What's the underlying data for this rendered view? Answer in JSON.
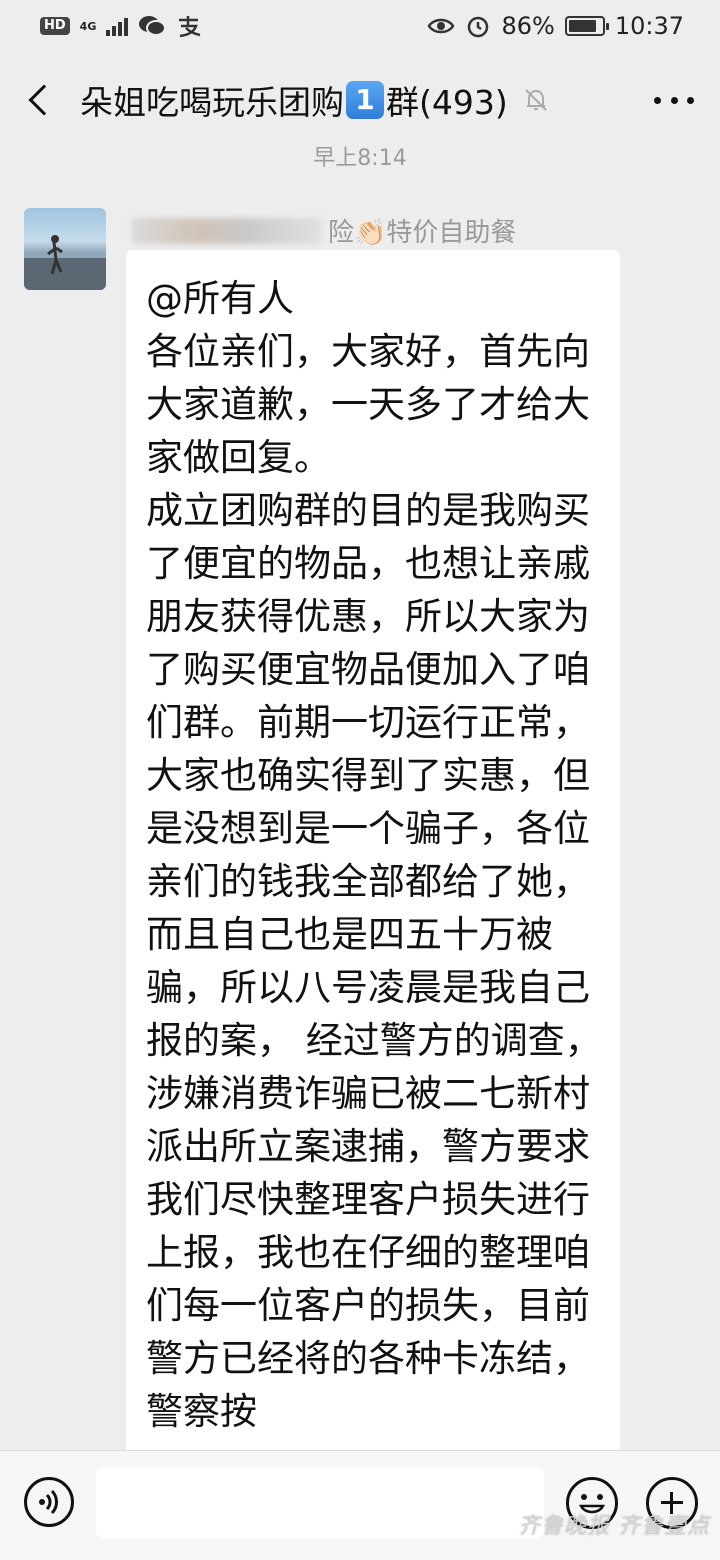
{
  "status_bar": {
    "hd": "HD",
    "network": "4G",
    "battery_percent": "86%",
    "battery_level": 0.86,
    "time": "10:37",
    "icons": [
      "wechat-icon",
      "alipay-icon",
      "eye-icon",
      "alarm-icon"
    ]
  },
  "header": {
    "title_prefix": "朵姐吃喝玩乐团购",
    "title_number": "1",
    "title_suffix": "群(493)",
    "muted_icon": "mute-bell-icon"
  },
  "chat": {
    "timestamp": "早上8:14",
    "messages": [
      {
        "sender_visible": "险👏🏻特价自助餐",
        "text": "@所有人\n各位亲们，大家好，首先向大家道歉，一天多了才给大家做回复。\n成立团购群的目的是我购买了便宜的物品，也想让亲戚朋友获得优惠，所以大家为了购买便宜物品便加入了咱们群。前期一切运行正常，大家也确实得到了实惠，但是没想到是一个骗子，各位亲们的钱我全部都给了她，而且自己也是四五十万被骗，所以八号凌晨是我自己报的案， 经过警方的调查，涉嫌消费诈骗已被二七新村派出所立案逮捕，警方要求我们尽快整理客户损失进行上报，我也在仔细的整理咱们每一位客户的损失，目前警方已经将的各种卡冻结，警察按"
      }
    ]
  },
  "watermark": "齐鲁晚报 齐鲁壹点"
}
